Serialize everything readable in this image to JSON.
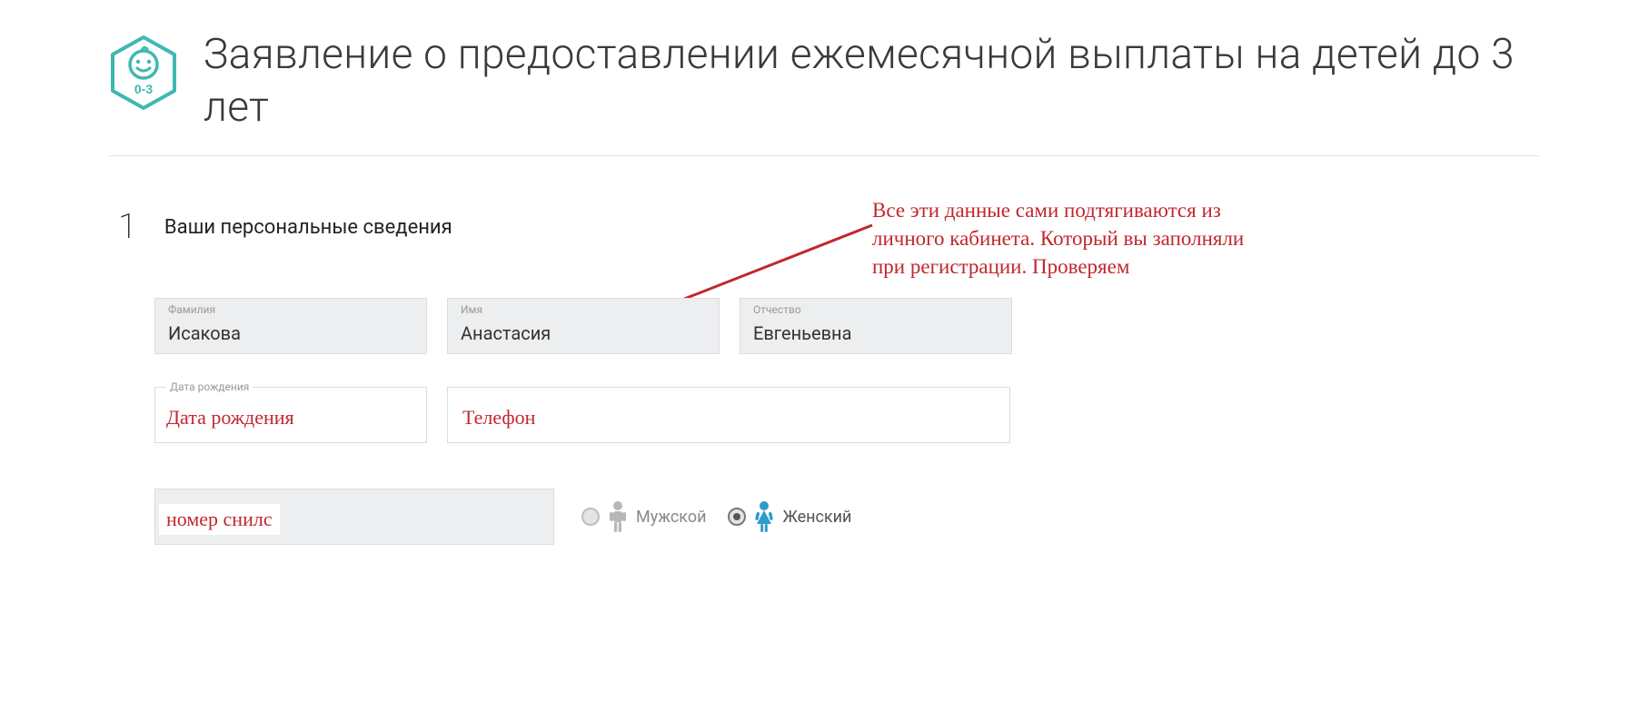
{
  "header": {
    "title": "Заявление о предоставлении ежемесячной выплаты на детей до 3 лет",
    "icon_badge": "0-3"
  },
  "step": {
    "number": "1",
    "title": "Ваши персональные сведения"
  },
  "annotation": {
    "text": "Все эти данные сами подтягиваются из личного кабинета. Который вы заполняли при регистрации. Проверяем"
  },
  "fields": {
    "lastname": {
      "label": "Фамилия",
      "value": "Исакова"
    },
    "firstname": {
      "label": "Имя",
      "value": "Анастасия"
    },
    "patronymic": {
      "label": "Отчество",
      "value": "Евгеньевна"
    },
    "dob": {
      "label": "Дата рождения",
      "overlay": "Дата рождения"
    },
    "phone": {
      "overlay": "Телефон"
    },
    "snils": {
      "overlay": "номер снилс"
    }
  },
  "gender": {
    "male": {
      "label": "Мужской",
      "selected": false
    },
    "female": {
      "label": "Женский",
      "selected": true
    }
  },
  "colors": {
    "accent_red": "#c1272d",
    "teal": "#3eb8b3",
    "blue": "#2e9cc9",
    "gray_icon": "#b7b7b7"
  }
}
